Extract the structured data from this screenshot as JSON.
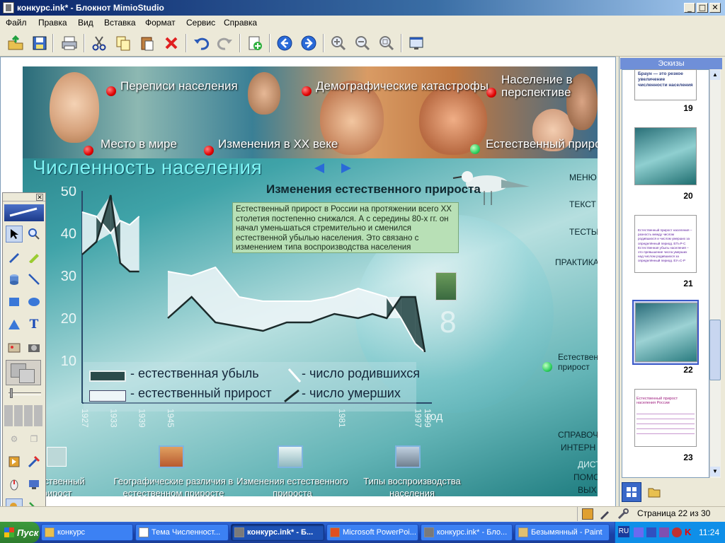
{
  "window": {
    "title": "конкурс.ink* - Блокнот MimioStudio",
    "controls": {
      "minimize": "_",
      "maximize": "□",
      "close": "✕"
    }
  },
  "menu": [
    "Файл",
    "Правка",
    "Вид",
    "Вставка",
    "Формат",
    "Сервис",
    "Справка"
  ],
  "toolbar_icons": [
    "open-icon",
    "save-icon",
    "print-icon",
    "cut-icon",
    "copy-icon",
    "paste-icon",
    "delete-icon",
    "undo-icon",
    "redo-icon",
    "new-page-icon",
    "back-icon",
    "forward-icon",
    "zoom-in-icon",
    "zoom-out-icon",
    "zoom-fit-icon",
    "screen-icon"
  ],
  "slide": {
    "banner_links": [
      "Переписи населения",
      "Демографические катастрофы",
      "Население в перспективе",
      "Место в мире",
      "Изменения в XX веке",
      "Естественный прирост"
    ],
    "title": "Численность населения",
    "side_menu": [
      "МЕНЮ",
      "ТЕКСТ",
      "ТЕСТЫ",
      "ПРАКТИКА"
    ],
    "side_link": "Естествен прирост",
    "bottom_side": [
      "СПРАВОЧН",
      "ИНТЕРН",
      "ДИСТ",
      "ПОМО",
      "ВЫХ"
    ],
    "bottom_links": [
      "Естественный прирост",
      "Географические различия в естественном приросте",
      "Изменения естественного прироста",
      "Типы воспроизводства населения"
    ],
    "big_number": "8",
    "chart_heading": "Изменения естественного прироста",
    "description": "Естественный прирост в России на протяжении всего XX столетия постепенно снижался. А с середины 80-х гг. он начал уменьшаться стремительно и сменился естественной убылью населения. Это связано с изменением типа воспроизводства населения",
    "x_axis_label": "год"
  },
  "chart_data": {
    "type": "line",
    "title": "Изменения естественного прироста",
    "xlabel": "год",
    "ylabel": "",
    "ylim": [
      0,
      50
    ],
    "yticks": [
      10,
      20,
      30,
      40,
      50
    ],
    "xticks": [
      "1927",
      "1933",
      "1939",
      "1945",
      "1981",
      "1997",
      "1999"
    ],
    "legend": [
      "естественная убыль",
      "естественный прирост",
      "число родившихся",
      "число умерших"
    ],
    "series": [
      {
        "name": "число родившихся",
        "x": [
          1927,
          1930,
          1933,
          1935,
          1937,
          1939,
          1945,
          1950,
          1955,
          1960,
          1965,
          1970,
          1975,
          1980,
          1985,
          1988,
          1991,
          1994,
          1997,
          1999
        ],
        "values": [
          45,
          44,
          40,
          43,
          42,
          44,
          31,
          30,
          32,
          25,
          24,
          24,
          24,
          25,
          27,
          26,
          25,
          20,
          14,
          12
        ]
      },
      {
        "name": "число умерших",
        "x": [
          1927,
          1930,
          1933,
          1935,
          1937,
          1939,
          1945,
          1950,
          1955,
          1960,
          1965,
          1970,
          1975,
          1980,
          1985,
          1988,
          1991,
          1994,
          1997,
          1999
        ],
        "values": [
          35,
          38,
          49,
          33,
          31,
          31,
          20,
          25,
          19,
          18,
          17,
          19,
          19,
          21,
          20,
          21,
          20,
          25,
          25,
          12
        ]
      }
    ]
  },
  "sketches": {
    "header": "Эскизы",
    "items": [
      {
        "num": "19",
        "text": "Браун — это резкое увеличение численности населения"
      },
      {
        "num": "20",
        "text": ""
      },
      {
        "num": "21",
        "text": "Естественный прирост населения – разность между числом родившихся и числом умерших за определённый период. ЕП=Р-С Естественная убыль населения – это превышение числа умерших над числом родившихся за определённый период. ЕУ=С-Р"
      },
      {
        "num": "22",
        "text": ""
      },
      {
        "num": "23",
        "text": "Естественный прирост населения России"
      }
    ]
  },
  "status": {
    "page": "Страница 22 из 30"
  },
  "taskbar": {
    "start": "Пуск",
    "tasks": [
      "конкурс",
      "Тема Численност...",
      "конкурс.ink* - Б...",
      "Microsoft PowerPoi...",
      "конкурс.ink* - Бло...",
      "Безымянный - Paint"
    ],
    "lang": "RU",
    "clock": "11:24"
  }
}
